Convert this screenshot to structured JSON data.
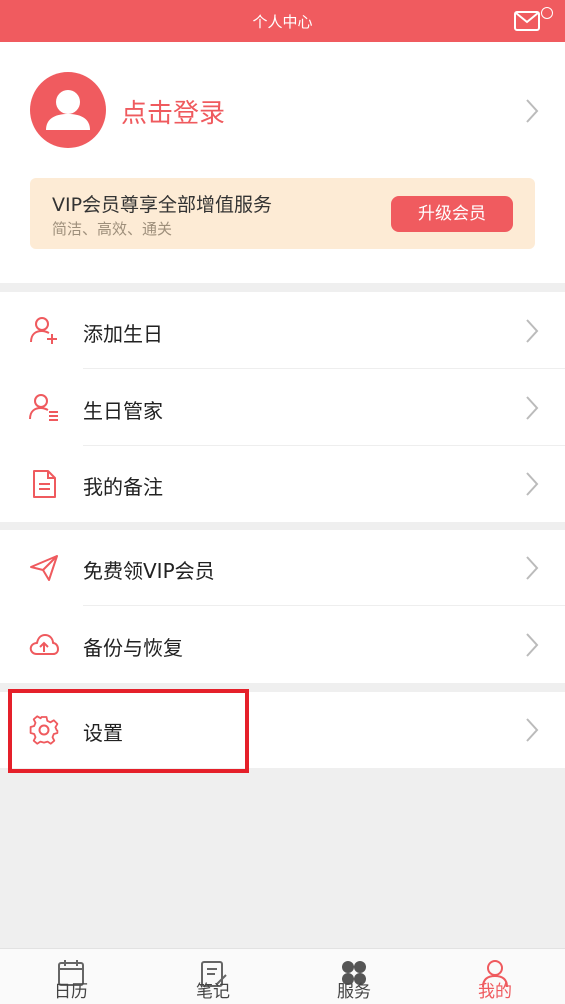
{
  "header": {
    "title": "个人中心",
    "mail_icon": "mail-icon"
  },
  "profile": {
    "login_text": "点击登录"
  },
  "vip_banner": {
    "title": "VIP会员尊享全部增值服务",
    "subtitle": "简洁、高效、通关",
    "button_label": "升级会员"
  },
  "menu_group1": [
    {
      "label": "添加生日",
      "icon": "add-user-icon"
    },
    {
      "label": "生日管家",
      "icon": "user-list-icon"
    },
    {
      "label": "我的备注",
      "icon": "document-icon"
    }
  ],
  "menu_group2": [
    {
      "label": "免费领VIP会员",
      "icon": "paper-plane-icon"
    },
    {
      "label": "备份与恢复",
      "icon": "cloud-upload-icon"
    }
  ],
  "menu_group3": [
    {
      "label": "设置",
      "icon": "gear-icon"
    }
  ],
  "tabbar": [
    {
      "label": "日历",
      "icon": "calendar-icon",
      "active": false
    },
    {
      "label": "笔记",
      "icon": "note-icon",
      "active": false
    },
    {
      "label": "服务",
      "icon": "grid-icon",
      "active": false
    },
    {
      "label": "我的",
      "icon": "user-icon",
      "active": true
    }
  ],
  "colors": {
    "accent": "#f05b5f",
    "vip_background": "#fdebd5",
    "highlight_border": "#e5202a"
  }
}
